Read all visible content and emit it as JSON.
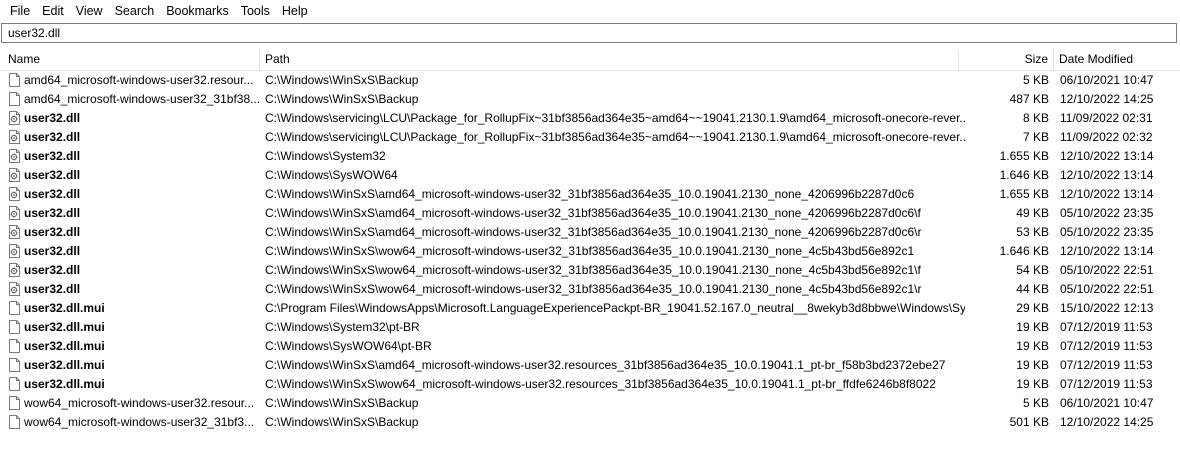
{
  "menu": [
    "File",
    "Edit",
    "View",
    "Search",
    "Bookmarks",
    "Tools",
    "Help"
  ],
  "search": {
    "value": "user32.dll"
  },
  "columns": {
    "name": "Name",
    "path": "Path",
    "size": "Size",
    "date": "Date Modified"
  },
  "rows": [
    {
      "name": "amd64_microsoft-windows-user32.resour...",
      "path": "C:\\Windows\\WinSxS\\Backup",
      "size": "5 KB",
      "date": "06/10/2021 10:47",
      "bold": false,
      "icon": "file-icon"
    },
    {
      "name": "amd64_microsoft-windows-user32_31bf38...",
      "path": "C:\\Windows\\WinSxS\\Backup",
      "size": "487 KB",
      "date": "12/10/2022 14:25",
      "bold": false,
      "icon": "file-icon"
    },
    {
      "name": "user32.dll",
      "path": "C:\\Windows\\servicing\\LCU\\Package_for_RollupFix~31bf3856ad364e35~amd64~~19041.2130.1.9\\amd64_microsoft-onecore-rever...",
      "size": "8 KB",
      "date": "11/09/2022 02:31",
      "bold": true,
      "icon": "dll-file-icon"
    },
    {
      "name": "user32.dll",
      "path": "C:\\Windows\\servicing\\LCU\\Package_for_RollupFix~31bf3856ad364e35~amd64~~19041.2130.1.9\\amd64_microsoft-onecore-rever...",
      "size": "7 KB",
      "date": "11/09/2022 02:32",
      "bold": true,
      "icon": "dll-file-icon"
    },
    {
      "name": "user32.dll",
      "path": "C:\\Windows\\System32",
      "size": "1.655 KB",
      "date": "12/10/2022 13:14",
      "bold": true,
      "icon": "dll-file-icon"
    },
    {
      "name": "user32.dll",
      "path": "C:\\Windows\\SysWOW64",
      "size": "1.646 KB",
      "date": "12/10/2022 13:14",
      "bold": true,
      "icon": "dll-file-icon"
    },
    {
      "name": "user32.dll",
      "path": "C:\\Windows\\WinSxS\\amd64_microsoft-windows-user32_31bf3856ad364e35_10.0.19041.2130_none_4206996b2287d0c6",
      "size": "1.655 KB",
      "date": "12/10/2022 13:14",
      "bold": true,
      "icon": "dll-file-icon"
    },
    {
      "name": "user32.dll",
      "path": "C:\\Windows\\WinSxS\\amd64_microsoft-windows-user32_31bf3856ad364e35_10.0.19041.2130_none_4206996b2287d0c6\\f",
      "size": "49 KB",
      "date": "05/10/2022 23:35",
      "bold": true,
      "icon": "dll-file-icon"
    },
    {
      "name": "user32.dll",
      "path": "C:\\Windows\\WinSxS\\amd64_microsoft-windows-user32_31bf3856ad364e35_10.0.19041.2130_none_4206996b2287d0c6\\r",
      "size": "53 KB",
      "date": "05/10/2022 23:35",
      "bold": true,
      "icon": "dll-file-icon"
    },
    {
      "name": "user32.dll",
      "path": "C:\\Windows\\WinSxS\\wow64_microsoft-windows-user32_31bf3856ad364e35_10.0.19041.2130_none_4c5b43bd56e892c1",
      "size": "1.646 KB",
      "date": "12/10/2022 13:14",
      "bold": true,
      "icon": "dll-file-icon"
    },
    {
      "name": "user32.dll",
      "path": "C:\\Windows\\WinSxS\\wow64_microsoft-windows-user32_31bf3856ad364e35_10.0.19041.2130_none_4c5b43bd56e892c1\\f",
      "size": "54 KB",
      "date": "05/10/2022 22:51",
      "bold": true,
      "icon": "dll-file-icon"
    },
    {
      "name": "user32.dll",
      "path": "C:\\Windows\\WinSxS\\wow64_microsoft-windows-user32_31bf3856ad364e35_10.0.19041.2130_none_4c5b43bd56e892c1\\r",
      "size": "44 KB",
      "date": "05/10/2022 22:51",
      "bold": true,
      "icon": "dll-file-icon"
    },
    {
      "name": "user32.dll.mui",
      "path": "C:\\Program Files\\WindowsApps\\Microsoft.LanguageExperiencePackpt-BR_19041.52.167.0_neutral__8wekyb3d8bbwe\\Windows\\Sy...",
      "size": "29 KB",
      "date": "15/10/2022 12:13",
      "bold": true,
      "icon": "file-icon"
    },
    {
      "name": "user32.dll.mui",
      "path": "C:\\Windows\\System32\\pt-BR",
      "size": "19 KB",
      "date": "07/12/2019 11:53",
      "bold": true,
      "icon": "file-icon"
    },
    {
      "name": "user32.dll.mui",
      "path": "C:\\Windows\\SysWOW64\\pt-BR",
      "size": "19 KB",
      "date": "07/12/2019 11:53",
      "bold": true,
      "icon": "file-icon"
    },
    {
      "name": "user32.dll.mui",
      "path": "C:\\Windows\\WinSxS\\amd64_microsoft-windows-user32.resources_31bf3856ad364e35_10.0.19041.1_pt-br_f58b3bd2372ebe27",
      "size": "19 KB",
      "date": "07/12/2019 11:53",
      "bold": true,
      "icon": "file-icon"
    },
    {
      "name": "user32.dll.mui",
      "path": "C:\\Windows\\WinSxS\\wow64_microsoft-windows-user32.resources_31bf3856ad364e35_10.0.19041.1_pt-br_ffdfe6246b8f8022",
      "size": "19 KB",
      "date": "07/12/2019 11:53",
      "bold": true,
      "icon": "file-icon"
    },
    {
      "name": "wow64_microsoft-windows-user32.resour...",
      "path": "C:\\Windows\\WinSxS\\Backup",
      "size": "5 KB",
      "date": "06/10/2021 10:47",
      "bold": false,
      "icon": "file-icon"
    },
    {
      "name": "wow64_microsoft-windows-user32_31bf3...",
      "path": "C:\\Windows\\WinSxS\\Backup",
      "size": "501 KB",
      "date": "12/10/2022 14:25",
      "bold": false,
      "icon": "file-icon"
    }
  ]
}
